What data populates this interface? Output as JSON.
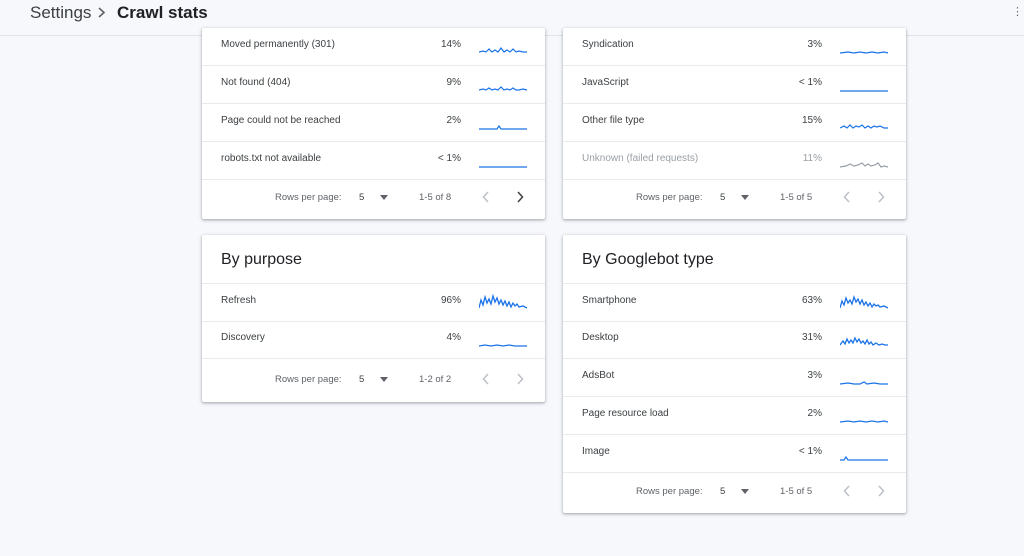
{
  "header": {
    "breadcrumb_root": "Settings",
    "breadcrumb_current": "Crawl stats",
    "edge_mark": "⋮"
  },
  "colors": {
    "spark": "#1a73e8",
    "spark_muted": "#9aa0a6"
  },
  "cards": {
    "response": {
      "rows": [
        {
          "label": "Moved permanently (301)",
          "pct": "14%"
        },
        {
          "label": "Not found (404)",
          "pct": "9%"
        },
        {
          "label": "Page could not be reached",
          "pct": "2%"
        },
        {
          "label": "robots.txt not available",
          "pct": "< 1%"
        }
      ],
      "pager": {
        "label": "Rows per page:",
        "value": "5",
        "range": "1-5 of 8"
      }
    },
    "filetype": {
      "rows": [
        {
          "label": "Syndication",
          "pct": "3%"
        },
        {
          "label": "JavaScript",
          "pct": "< 1%"
        },
        {
          "label": "Other file type",
          "pct": "15%"
        },
        {
          "label": "Unknown (failed requests)",
          "pct": "11%"
        }
      ],
      "pager": {
        "label": "Rows per page:",
        "value": "5",
        "range": "1-5 of 5"
      }
    },
    "purpose": {
      "title": "By purpose",
      "rows": [
        {
          "label": "Refresh",
          "pct": "96%"
        },
        {
          "label": "Discovery",
          "pct": "4%"
        }
      ],
      "pager": {
        "label": "Rows per page:",
        "value": "5",
        "range": "1-2 of 2"
      }
    },
    "googlebot": {
      "title": "By Googlebot type",
      "rows": [
        {
          "label": "Smartphone",
          "pct": "63%"
        },
        {
          "label": "Desktop",
          "pct": "31%"
        },
        {
          "label": "AdsBot",
          "pct": "3%"
        },
        {
          "label": "Page resource load",
          "pct": "2%"
        },
        {
          "label": "Image",
          "pct": "< 1%"
        }
      ],
      "pager": {
        "label": "Rows per page:",
        "value": "5",
        "range": "1-5 of 5"
      }
    }
  }
}
